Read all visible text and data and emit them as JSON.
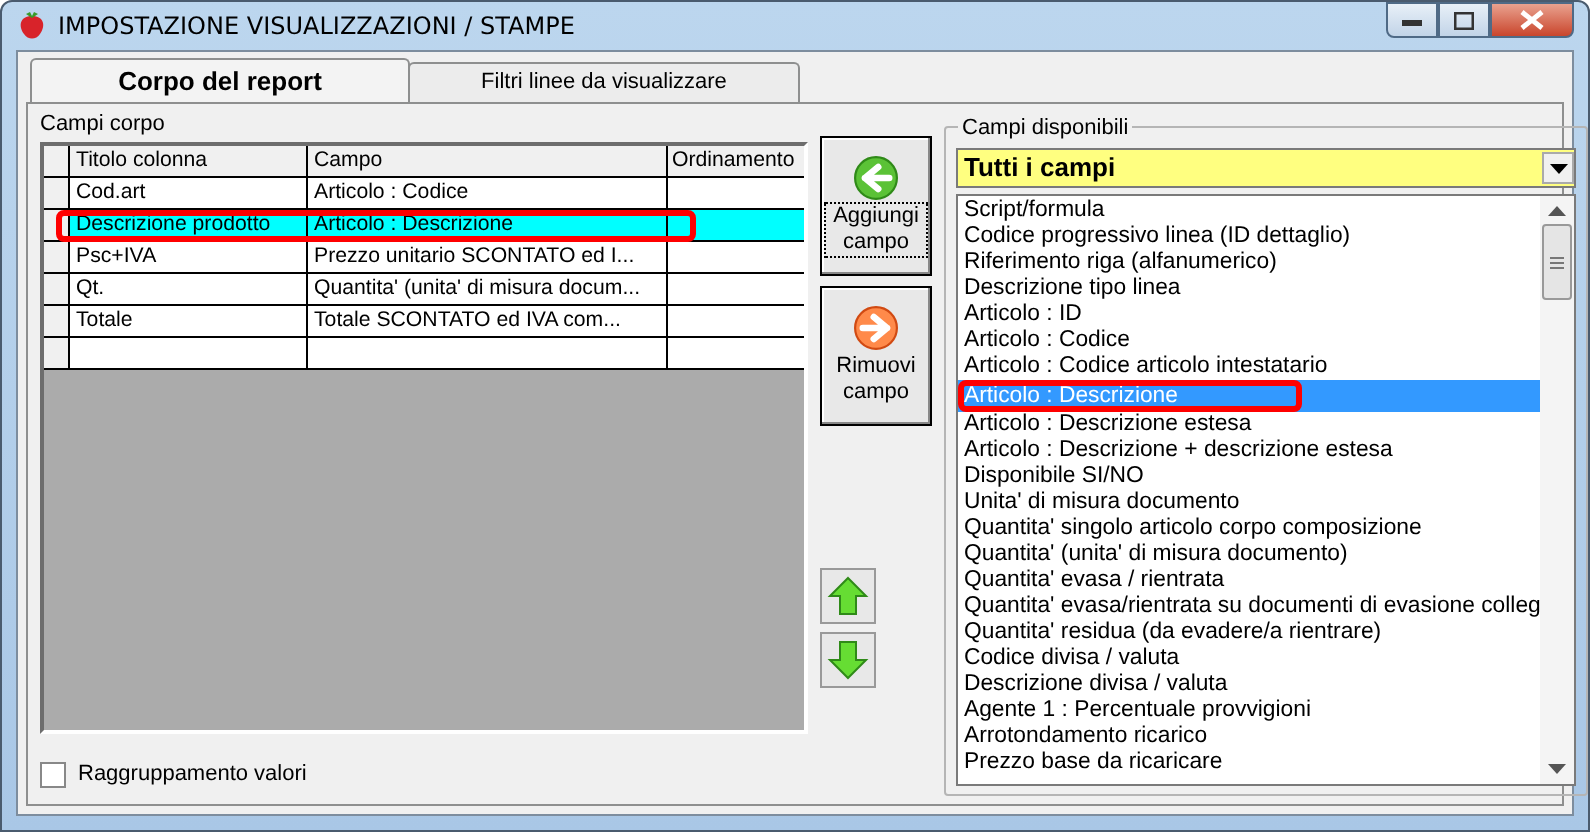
{
  "window": {
    "title": "IMPOSTAZIONE VISUALIZZAZIONI / STAMPE"
  },
  "tabs": [
    {
      "label": "Corpo del report",
      "selected": true
    },
    {
      "label": "Filtri linee da visualizzare",
      "selected": false
    }
  ],
  "body_fields": {
    "label": "Campi corpo",
    "columns": [
      "Titolo colonna",
      "Campo",
      "Ordinamento"
    ],
    "rows": [
      {
        "cells": [
          "Cod.art",
          "Articolo : Codice"
        ],
        "selected": false,
        "highlighted": false
      },
      {
        "cells": [
          "Descrizione prodotto",
          "Articolo : Descrizione"
        ],
        "selected": true,
        "highlighted": true
      },
      {
        "cells": [
          "Psc+IVA",
          "Prezzo unitario SCONTATO ed I..."
        ],
        "selected": false,
        "highlighted": false
      },
      {
        "cells": [
          "Qt.",
          "Quantita' (unita' di misura docum..."
        ],
        "selected": false,
        "highlighted": false
      },
      {
        "cells": [
          "Totale",
          "Totale SCONTATO ed IVA com..."
        ],
        "selected": false,
        "highlighted": false
      }
    ]
  },
  "buttons": [
    {
      "label": "Aggiungi campo",
      "kind": "add",
      "focused": true
    },
    {
      "label": "Rimuovi campo",
      "kind": "remove",
      "focused": false
    }
  ],
  "move_buttons": [
    {
      "kind": "up"
    },
    {
      "kind": "down"
    }
  ],
  "available_fields": {
    "label": "Campi disponibili",
    "filter": "Tutti i campi",
    "items": [
      {
        "label": "Script/formula",
        "selected": false,
        "highlighted": false
      },
      {
        "label": "Codice progressivo linea (ID dettaglio)",
        "selected": false,
        "highlighted": false
      },
      {
        "label": "Riferimento riga (alfanumerico)",
        "selected": false,
        "highlighted": false
      },
      {
        "label": "Descrizione tipo linea",
        "selected": false,
        "highlighted": false
      },
      {
        "label": "Articolo : ID",
        "selected": false,
        "highlighted": false
      },
      {
        "label": "Articolo : Codice",
        "selected": false,
        "highlighted": false
      },
      {
        "label": "Articolo : Codice articolo intestatario",
        "selected": false,
        "highlighted": false
      },
      {
        "label": "Articolo : Descrizione",
        "selected": true,
        "highlighted": true
      },
      {
        "label": "Articolo : Descrizione estesa",
        "selected": false,
        "highlighted": false
      },
      {
        "label": "Articolo : Descrizione + descrizione estesa",
        "selected": false,
        "highlighted": false
      },
      {
        "label": "Disponibile SI/NO",
        "selected": false,
        "highlighted": false
      },
      {
        "label": "Unita' di misura documento",
        "selected": false,
        "highlighted": false
      },
      {
        "label": "Quantita' singolo articolo corpo composizione",
        "selected": false,
        "highlighted": false
      },
      {
        "label": "Quantita' (unita' di misura documento)",
        "selected": false,
        "highlighted": false
      },
      {
        "label": "Quantita' evasa / rientrata",
        "selected": false,
        "highlighted": false
      },
      {
        "label": "Quantita' evasa/rientrata su documenti di evasione colleg",
        "selected": false,
        "highlighted": false
      },
      {
        "label": "Quantita' residua (da evadere/a rientrare)",
        "selected": false,
        "highlighted": false
      },
      {
        "label": "Codice divisa / valuta",
        "selected": false,
        "highlighted": false
      },
      {
        "label": "Descrizione divisa / valuta",
        "selected": false,
        "highlighted": false
      },
      {
        "label": "Agente 1 : Percentuale provvigioni",
        "selected": false,
        "highlighted": false
      },
      {
        "label": "Arrotondamento ricarico",
        "selected": false,
        "highlighted": false
      },
      {
        "label": "Prezzo base da ricaricare",
        "selected": false,
        "highlighted": false
      }
    ]
  },
  "grouping_checkbox": {
    "label": "Raggruppamento valori",
    "checked": false
  }
}
